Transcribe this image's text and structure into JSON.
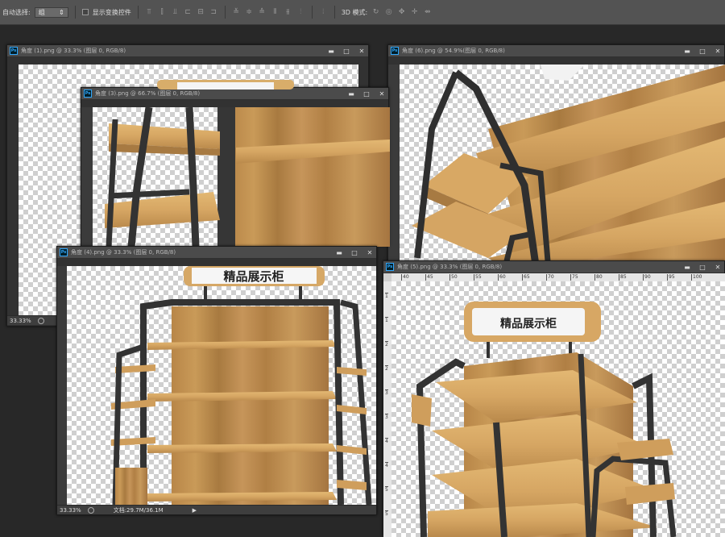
{
  "toolbar": {
    "auto_select_label": "自动选择:",
    "auto_select_value": "组",
    "show_transform_label": "显示变换控件",
    "mode_3d_label": "3D 模式:"
  },
  "documents": [
    {
      "title": "角度 (1).png @ 33.3% (图层 0, RGB/8)",
      "zoom": "33.33%"
    },
    {
      "title": "角度 (6).png @ 54.9%(图层 0, RGB/8)"
    },
    {
      "title": "角度 (3).png @ 66.7% (图层 0, RGB/8)"
    },
    {
      "title": "角度 (4).png @ 33.3% (图层 0, RGB/8)",
      "zoom": "33.33%",
      "doc_size": "文档:29.7M/36.1M"
    },
    {
      "title": "角度 (5).png @ 33.3% (图层 0, RGB/8)",
      "ruler_ticks": [
        "40",
        "45",
        "50",
        "55",
        "60",
        "65",
        "70",
        "75",
        "80",
        "85",
        "90",
        "95",
        "100"
      ],
      "ruler_v_ticks": [
        "1",
        "1",
        "2",
        "2",
        "3",
        "3",
        "4",
        "4",
        "5",
        "5"
      ]
    }
  ],
  "window_buttons": {
    "minimize": "▬",
    "maximize": "□",
    "close": "✕"
  },
  "sign_text": "精品展示柜",
  "colors": {
    "wood": "#c99a58",
    "wood_dark": "#a6783d",
    "frame": "#333333",
    "panel": "#323232"
  }
}
